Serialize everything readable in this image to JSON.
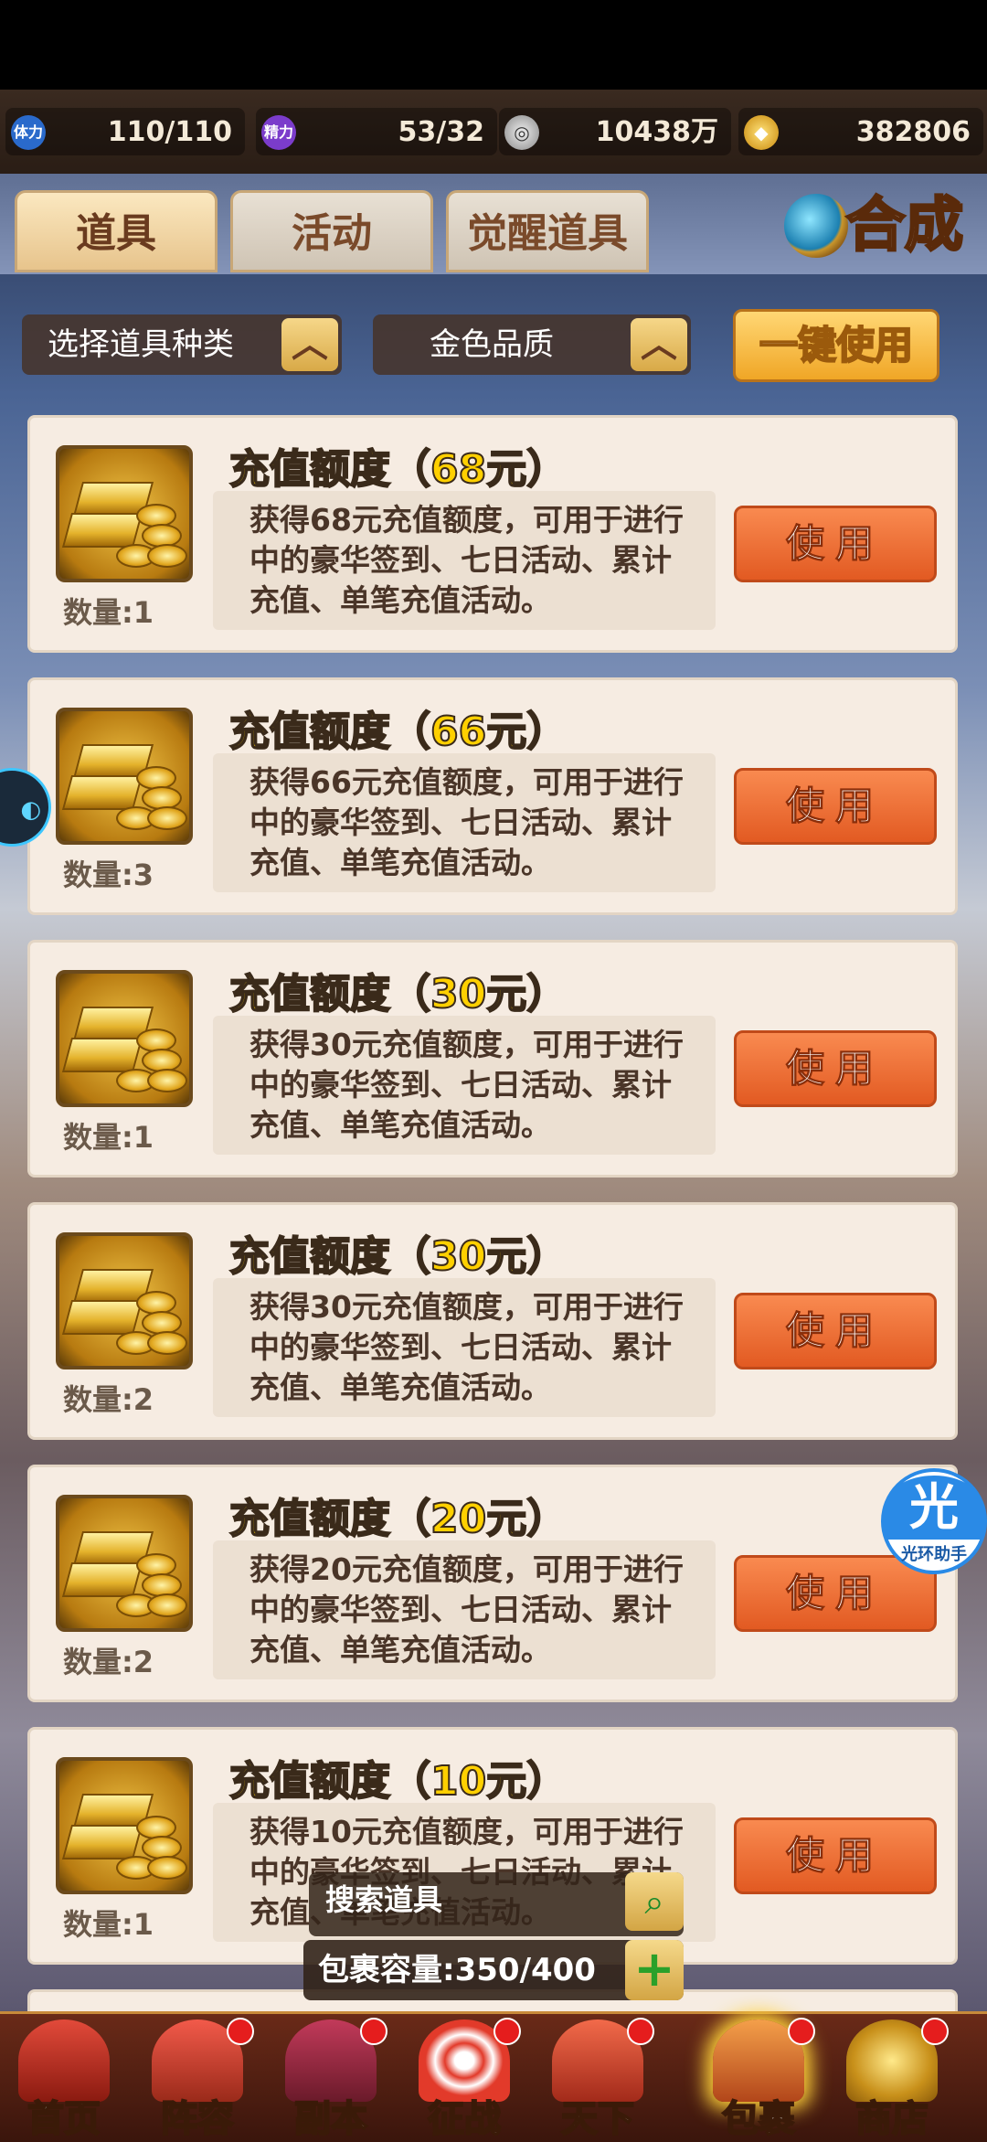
{
  "resources": [
    {
      "icon": "体力",
      "value": "110/110",
      "color": "#2a6acb"
    },
    {
      "icon": "精力",
      "value": "53/32",
      "color": "#7b3ccb"
    },
    {
      "icon": "coin",
      "value": "10438万",
      "color": "#9a9a9a"
    },
    {
      "icon": "ingot",
      "value": "382806",
      "color": "#e0a020"
    }
  ],
  "tabs": [
    {
      "label": "道具",
      "active": true
    },
    {
      "label": "活动",
      "active": false
    },
    {
      "label": "觉醒道具",
      "active": false
    }
  ],
  "compose_label": "合成",
  "filters": {
    "type_label": "选择道具种类",
    "quality_label": "金色品质",
    "one_key_label": "一键使用"
  },
  "items": [
    {
      "title": "充值额度（68元）",
      "desc": "获得68元充值额度，可用于进行中的豪华签到、七日活动、累计充值、单笔充值活动。",
      "qty": "数量:1",
      "button": "使用"
    },
    {
      "title": "充值额度（66元）",
      "desc": "获得66元充值额度，可用于进行中的豪华签到、七日活动、累计充值、单笔充值活动。",
      "qty": "数量:3",
      "button": "使用"
    },
    {
      "title": "充值额度（30元）",
      "desc": "获得30元充值额度，可用于进行中的豪华签到、七日活动、累计充值、单笔充值活动。",
      "qty": "数量:1",
      "button": "使用"
    },
    {
      "title": "充值额度（30元）",
      "desc": "获得30元充值额度，可用于进行中的豪华签到、七日活动、累计充值、单笔充值活动。",
      "qty": "数量:2",
      "button": "使用"
    },
    {
      "title": "充值额度（20元）",
      "desc": "获得20元充值额度，可用于进行中的豪华签到、七日活动、累计充值、单笔充值活动。",
      "qty": "数量:2",
      "button": "使用"
    },
    {
      "title": "充值额度（10元）",
      "desc": "获得10元充值额度，可用于进行中的豪华签到、七日活动、累计充值、单笔充值活动。",
      "qty": "数量:1",
      "button": "使用"
    }
  ],
  "search_label": "搜索道具",
  "capacity_label": "包裹容量:350/400",
  "helper": {
    "big": "光",
    "small": "光环助手"
  },
  "nav": [
    {
      "label": "首页",
      "color": "#c23a2a",
      "dot": false,
      "active": false
    },
    {
      "label": "阵容",
      "color": "#d4453a",
      "dot": true,
      "active": false
    },
    {
      "label": "副本",
      "color": "#a22a4a",
      "dot": true,
      "active": false
    },
    {
      "label": "征战",
      "color": "#c63a3a",
      "dot": true,
      "active": false
    },
    {
      "label": "天下",
      "color": "#d84a3a",
      "dot": true,
      "active": false
    },
    {
      "label": "包裹",
      "color": "#d0602a",
      "dot": true,
      "active": true
    },
    {
      "label": "商店",
      "color": "#d8a232",
      "dot": true,
      "active": false
    }
  ]
}
